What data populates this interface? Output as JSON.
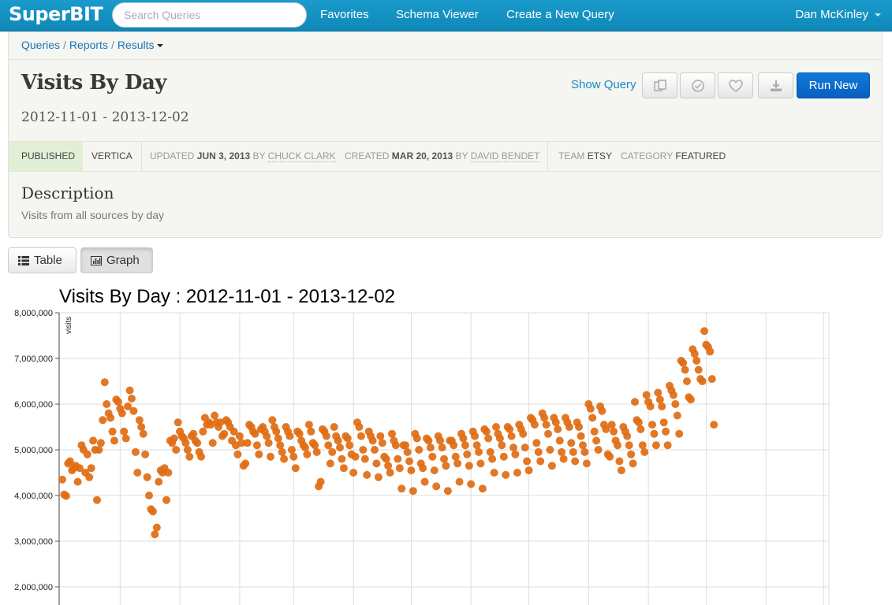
{
  "navbar": {
    "brand": "SuperBIT",
    "search_placeholder": "Search Queries",
    "links": [
      "Favorites",
      "Schema Viewer",
      "Create a New Query"
    ],
    "user": "Dan McKinley"
  },
  "breadcrumb": [
    "Queries",
    "Reports",
    "Results"
  ],
  "query": {
    "title": "Visits By Day",
    "date_range": "2012-11-01 - 2013-12-02",
    "show_query": "Show Query",
    "run_new": "Run New"
  },
  "meta": {
    "status": "PUBLISHED",
    "database": "VERTICA",
    "updated_label": "UPDATED",
    "updated_date": "JUN 3, 2013",
    "updated_by_label": "BY",
    "updated_by": "CHUCK CLARK",
    "created_label": "CREATED",
    "created_date": "MAR 20, 2013",
    "created_by_label": "BY",
    "created_by": "DAVID BENDET",
    "team_label": "TEAM",
    "team": "ETSY",
    "category_label": "CATEGORY",
    "category": "FEATURED"
  },
  "description": {
    "heading": "Description",
    "text": "Visits from all sources by day"
  },
  "view_tabs": {
    "table": "Table",
    "graph": "Graph",
    "active": "graph"
  },
  "colors": {
    "navbar": "#1a9bcb",
    "run_button": "#0a6fd0",
    "published_bg": "#e0efd6",
    "point": "#e06c12"
  },
  "chart_data": {
    "type": "scatter",
    "title": "Visits By Day : 2012-11-01 - 2013-12-02",
    "ylabel": "visits",
    "xlabel": "",
    "x_start": "2012-11-01",
    "x_end": "2013-12-02",
    "ylim": [
      1700000,
      8000000
    ],
    "yticks": [
      2000000,
      3000000,
      4000000,
      5000000,
      6000000,
      7000000,
      8000000
    ],
    "ytick_labels": [
      "2,000,000",
      "3,000,000",
      "4,000,000",
      "5,000,000",
      "6,000,000",
      "7,000,000",
      "8,000,000"
    ],
    "grid": true,
    "color": "#e06c12",
    "series": [
      {
        "values": [
          4350000,
          4020000,
          3990000,
          4700000,
          4750000,
          4550000,
          4600000,
          4650000,
          4300000,
          4600000,
          5100000,
          5000000,
          4500000,
          4900000,
          4400000,
          4600000,
          5200000,
          5000000,
          3900000,
          5000000,
          5150000,
          5650000,
          6480000,
          6000000,
          5800000,
          5700000,
          5400000,
          5200000,
          6100000,
          6050000,
          5900000,
          5800000,
          5400000,
          5250000,
          5950000,
          6300000,
          6120000,
          5850000,
          4950000,
          4500000,
          5650000,
          5500000,
          5350000,
          4900000,
          4400000,
          4000000,
          3700000,
          3650000,
          3150000,
          3300000,
          4300000,
          4550000,
          4500000,
          4600000,
          3900000,
          4500000,
          5200000,
          5150000,
          5250000,
          5000000,
          5600000,
          5400000,
          5300000,
          5250000,
          5150000,
          5000000,
          4850000,
          5300000,
          5350000,
          5200000,
          5150000,
          4950000,
          4850000,
          5400000,
          5700000,
          5550000,
          5600000,
          5550000,
          5150000,
          5750000,
          5600000,
          5500000,
          5600000,
          5300000,
          5350000,
          5650000,
          5600000,
          5500000,
          5200000,
          5400000,
          5100000,
          4900000,
          5300000,
          5150000,
          4650000,
          4700000,
          5150000,
          5550000,
          5500000,
          5400000,
          5350000,
          5100000,
          4900000,
          5450000,
          5500000,
          5400000,
          5300000,
          5150000,
          4850000,
          5650000,
          5500000,
          5400000,
          5250000,
          5100000,
          4950000,
          4800000,
          5500000,
          5400000,
          5300000,
          5000000,
          4850000,
          4600000,
          5400000,
          5350000,
          5200000,
          5100000,
          5050000,
          4900000,
          5550000,
          5400000,
          5150000,
          5100000,
          4950000,
          4200000,
          4300000,
          5450000,
          5400000,
          5300000,
          5100000,
          4700000,
          4950000,
          5500000,
          5300000,
          5200000,
          5050000,
          4800000,
          4600000,
          5300000,
          5250000,
          5100000,
          4900000,
          4500000,
          4850000,
          5600000,
          5500000,
          5300000,
          5000000,
          4800000,
          4450000,
          5400000,
          5300000,
          5200000,
          5000000,
          4700000,
          4400000,
          5300000,
          5150000,
          4850000,
          4800000,
          4650000,
          4500000,
          5350000,
          5200000,
          5100000,
          4800000,
          4600000,
          4150000,
          5100000,
          5100000,
          4950000,
          4750000,
          4550000,
          4100000,
          5350000,
          5250000,
          5000000,
          4700000,
          4600000,
          4300000,
          5250000,
          5200000,
          5050000,
          4850000,
          4550000,
          4200000,
          5300000,
          5200000,
          5050000,
          4800000,
          4650000,
          4100000,
          5200000,
          5200000,
          5100000,
          4850000,
          4700000,
          4300000,
          5350000,
          5250000,
          5100000,
          4900000,
          4650000,
          4250000,
          5400000,
          5300000,
          5100000,
          4950000,
          4700000,
          4150000,
          5450000,
          5400000,
          5250000,
          4950000,
          4800000,
          4500000,
          5500000,
          5350000,
          5250000,
          5100000,
          4850000,
          4450000,
          5500000,
          5450000,
          5300000,
          5050000,
          4900000,
          4500000,
          5550000,
          5450000,
          5350000,
          5050000,
          4750000,
          4550000,
          5700000,
          5650000,
          5550000,
          5150000,
          4950000,
          4750000,
          5800000,
          5700000,
          5550000,
          5350000,
          5000000,
          4650000,
          5700000,
          5600000,
          5450000,
          5200000,
          4950000,
          4800000,
          5700000,
          5600000,
          5500000,
          5150000,
          4950000,
          4750000,
          5600000,
          5500000,
          5300000,
          5100000,
          4950000,
          4700000,
          6000000,
          5900000,
          5700000,
          5400000,
          5200000,
          5000000,
          5950000,
          5850000,
          5550000,
          5450000,
          4900000,
          4850000,
          5550000,
          5400000,
          5200000,
          5100000,
          4750000,
          4550000,
          5500000,
          5400000,
          5300000,
          5100000,
          4900000,
          4700000,
          6050000,
          5650000,
          5600000,
          5450000,
          5100000,
          4950000,
          6200000,
          6050000,
          5950000,
          5550000,
          5350000,
          5100000,
          6250000,
          6100000,
          5950000,
          5600000,
          5400000,
          5100000,
          6400000,
          6300000,
          6200000,
          6000000,
          5750000,
          5350000,
          6950000,
          6900000,
          6750000,
          6500000,
          6150000,
          6100000,
          7200000,
          7100000,
          6950000,
          6750000,
          6550000,
          6500000,
          7600000,
          7300000,
          7250000,
          7150000,
          6550000,
          5550000
        ]
      }
    ]
  }
}
